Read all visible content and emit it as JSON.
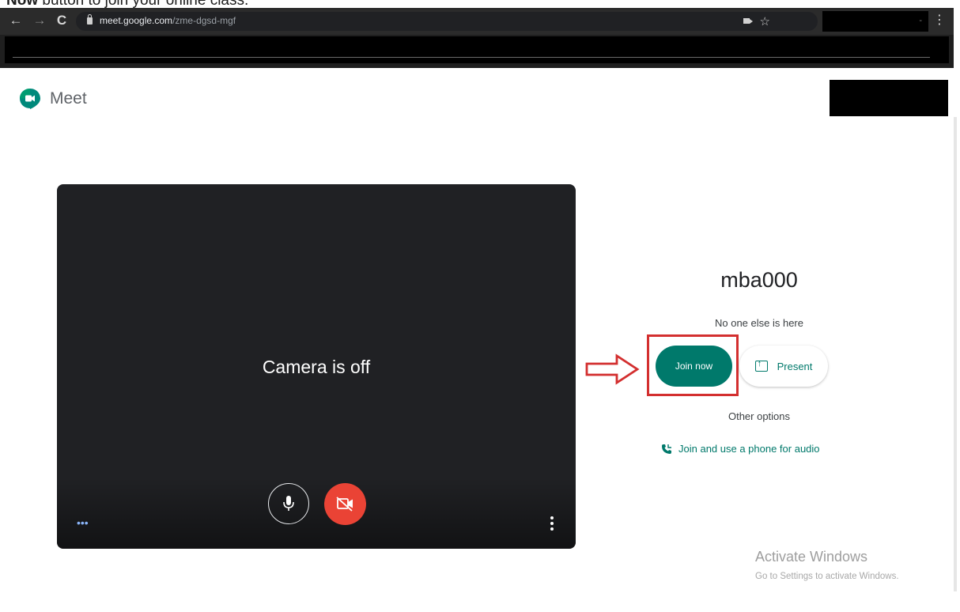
{
  "caption": {
    "bold": "Now",
    "rest": " button to join your online class."
  },
  "browser": {
    "url_domain": "meet.google.com",
    "url_path": "/zme-dgsd-mgf"
  },
  "meet": {
    "app_name": "Meet",
    "camera_status": "Camera is off",
    "meeting_code": "mba000",
    "participants_status": "No one else is here",
    "join_label": "Join now",
    "present_label": "Present",
    "other_options": "Other options",
    "phone_audio_label": "Join and use a phone for audio"
  },
  "watermark": {
    "title": "Activate Windows",
    "subtitle": "Go to Settings to activate Windows."
  },
  "colors": {
    "accent": "#00796b",
    "camera_off_red": "#ea4335",
    "highlight_red": "#d32f2f"
  }
}
